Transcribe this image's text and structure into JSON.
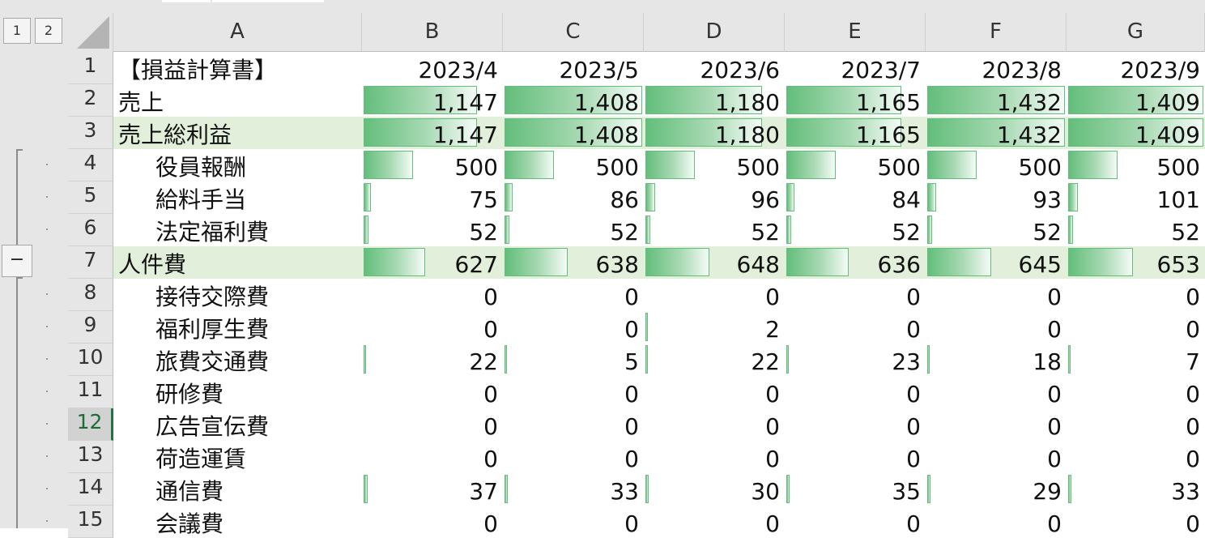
{
  "outline": {
    "level_buttons": [
      "1",
      "2"
    ],
    "collapse_symbol": "−"
  },
  "columns": [
    "A",
    "B",
    "C",
    "D",
    "E",
    "F",
    "G"
  ],
  "header_row": {
    "label": "【損益計算書】",
    "months": [
      "2023/4",
      "2023/5",
      "2023/6",
      "2023/7",
      "2023/8",
      "2023/9"
    ]
  },
  "rows": [
    {
      "num": "2",
      "label": "売上",
      "indent": false,
      "total": false,
      "values": [
        1147,
        1408,
        1180,
        1165,
        1432,
        1409
      ],
      "display": [
        "1,147",
        "1,408",
        "1,180",
        "1,165",
        "1,432",
        "1,409"
      ],
      "bars": true
    },
    {
      "num": "3",
      "label": "売上総利益",
      "indent": false,
      "total": true,
      "values": [
        1147,
        1408,
        1180,
        1165,
        1432,
        1409
      ],
      "display": [
        "1,147",
        "1,408",
        "1,180",
        "1,165",
        "1,432",
        "1,409"
      ],
      "bars": true
    },
    {
      "num": "4",
      "label": "役員報酬",
      "indent": true,
      "total": false,
      "values": [
        500,
        500,
        500,
        500,
        500,
        500
      ],
      "display": [
        "500",
        "500",
        "500",
        "500",
        "500",
        "500"
      ],
      "bars": true
    },
    {
      "num": "5",
      "label": "給料手当",
      "indent": true,
      "total": false,
      "values": [
        75,
        86,
        96,
        84,
        93,
        101
      ],
      "display": [
        "75",
        "86",
        "96",
        "84",
        "93",
        "101"
      ],
      "bars": true
    },
    {
      "num": "6",
      "label": "法定福利費",
      "indent": true,
      "total": false,
      "values": [
        52,
        52,
        52,
        52,
        52,
        52
      ],
      "display": [
        "52",
        "52",
        "52",
        "52",
        "52",
        "52"
      ],
      "bars": true
    },
    {
      "num": "7",
      "label": "人件費",
      "indent": false,
      "total": true,
      "values": [
        627,
        638,
        648,
        636,
        645,
        653
      ],
      "display": [
        "627",
        "638",
        "648",
        "636",
        "645",
        "653"
      ],
      "bars": true
    },
    {
      "num": "8",
      "label": "接待交際費",
      "indent": true,
      "total": false,
      "values": [
        0,
        0,
        0,
        0,
        0,
        0
      ],
      "display": [
        "0",
        "0",
        "0",
        "0",
        "0",
        "0"
      ],
      "bars": true
    },
    {
      "num": "9",
      "label": "福利厚生費",
      "indent": true,
      "total": false,
      "values": [
        0,
        0,
        2,
        0,
        0,
        0
      ],
      "display": [
        "0",
        "0",
        "2",
        "0",
        "0",
        "0"
      ],
      "bars": true
    },
    {
      "num": "10",
      "label": "旅費交通費",
      "indent": true,
      "total": false,
      "values": [
        22,
        5,
        22,
        23,
        18,
        7
      ],
      "display": [
        "22",
        "5",
        "22",
        "23",
        "18",
        "7"
      ],
      "bars": true
    },
    {
      "num": "11",
      "label": "研修費",
      "indent": true,
      "total": false,
      "values": [
        0,
        0,
        0,
        0,
        0,
        0
      ],
      "display": [
        "0",
        "0",
        "0",
        "0",
        "0",
        "0"
      ],
      "bars": true
    },
    {
      "num": "12",
      "label": "広告宣伝費",
      "indent": true,
      "total": false,
      "values": [
        0,
        0,
        0,
        0,
        0,
        0
      ],
      "display": [
        "0",
        "0",
        "0",
        "0",
        "0",
        "0"
      ],
      "bars": true
    },
    {
      "num": "13",
      "label": "荷造運賃",
      "indent": true,
      "total": false,
      "values": [
        0,
        0,
        0,
        0,
        0,
        0
      ],
      "display": [
        "0",
        "0",
        "0",
        "0",
        "0",
        "0"
      ],
      "bars": true
    },
    {
      "num": "14",
      "label": "通信費",
      "indent": true,
      "total": false,
      "values": [
        37,
        33,
        30,
        35,
        29,
        33
      ],
      "display": [
        "37",
        "33",
        "30",
        "35",
        "29",
        "33"
      ],
      "bars": true
    },
    {
      "num": "15",
      "label": "会議費",
      "indent": true,
      "total": false,
      "values": [
        0,
        0,
        0,
        0,
        0,
        0
      ],
      "display": [
        "0",
        "0",
        "0",
        "0",
        "0",
        "0"
      ],
      "bars": true
    }
  ],
  "selected_row": "12",
  "colors": {
    "bar_fill": "#63be7b",
    "total_row_fill": "#e2efda",
    "header_fill": "#e6e6e6",
    "selection_accent": "#217346"
  }
}
